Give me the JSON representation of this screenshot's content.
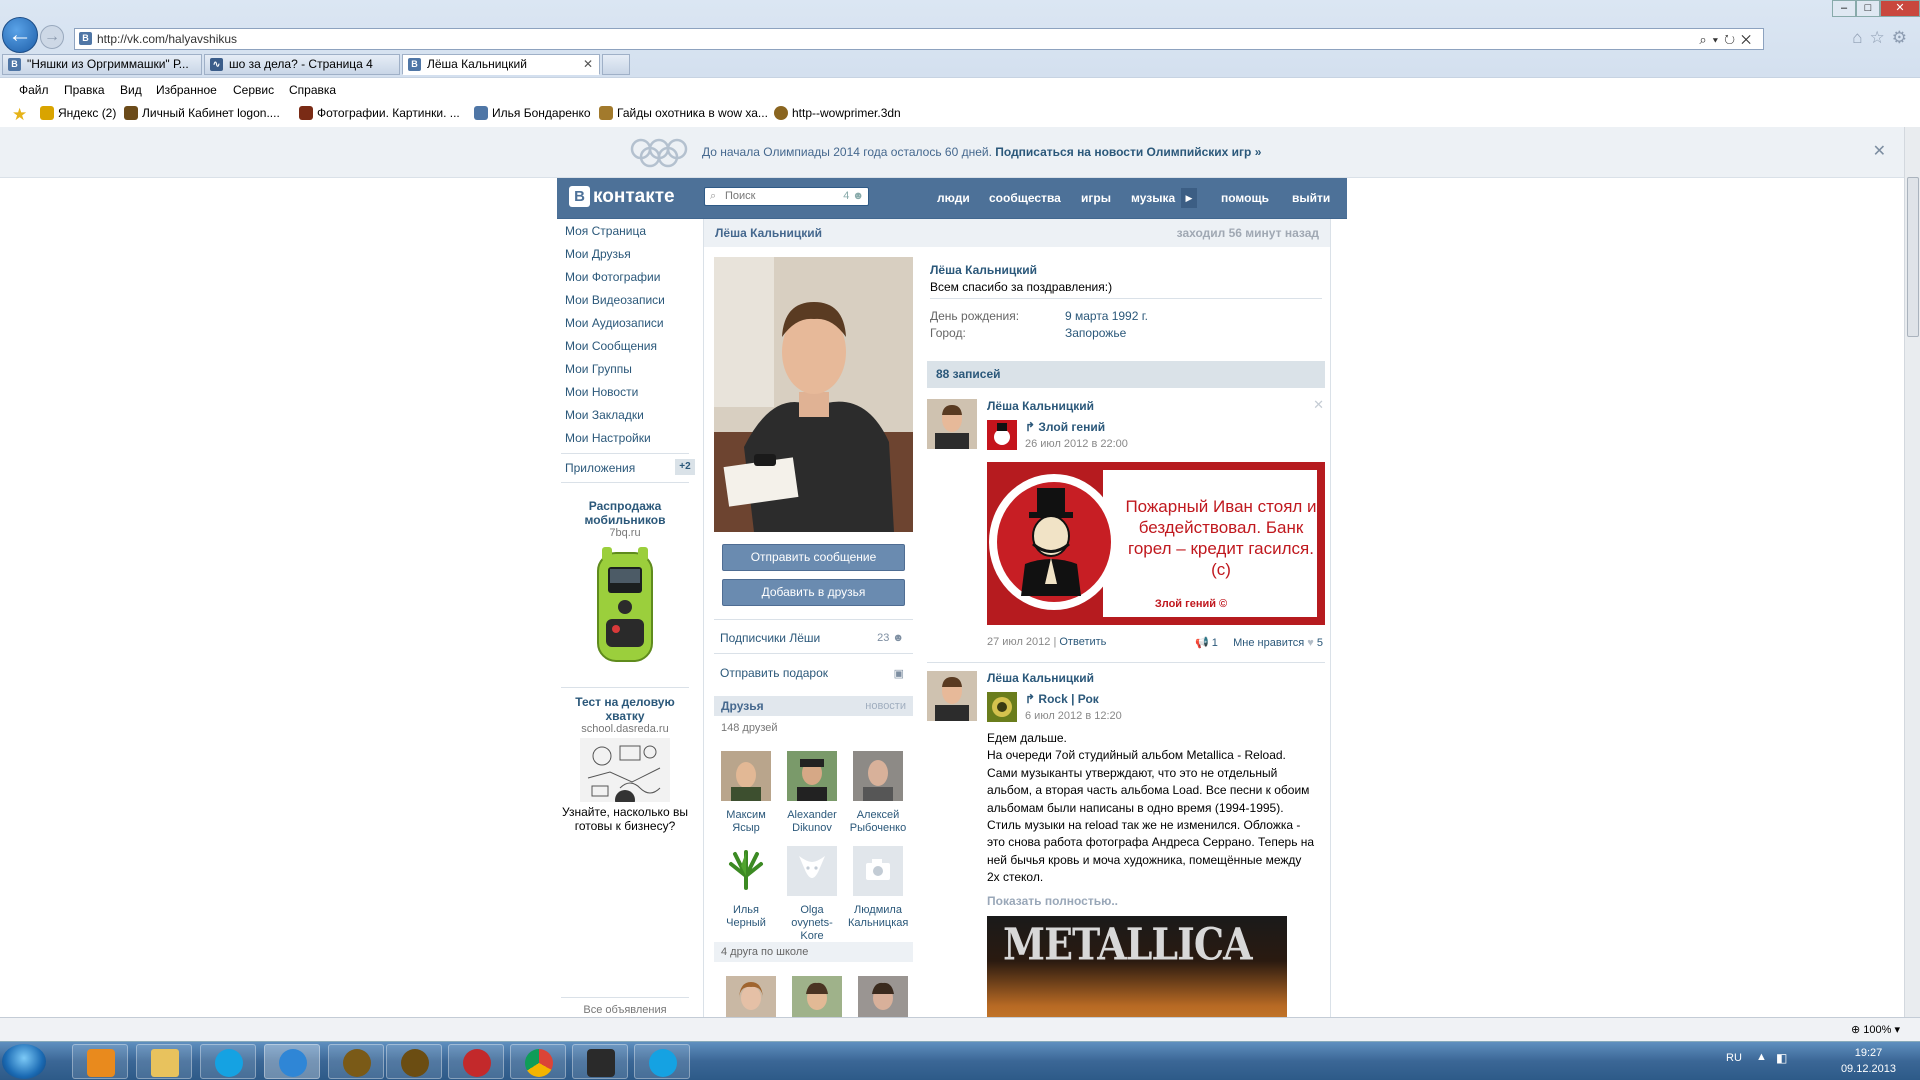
{
  "browser": {
    "url": "http://vk.com/halyavshikus",
    "tabs": [
      {
        "label": "\"Няшки из Оргриммашки\" Р..."
      },
      {
        "label": "шо за дела? - Страница 4"
      },
      {
        "label": "Лёша Кальницкий"
      }
    ],
    "menu": [
      "Файл",
      "Правка",
      "Вид",
      "Избранное",
      "Сервис",
      "Справка"
    ],
    "favorites": [
      {
        "label": "Яндекс (2)",
        "color": "#d9a400"
      },
      {
        "label": "Личный Кабинет logon....",
        "color": "#6b4b1a"
      },
      {
        "label": "Фотографии. Картинки. ...",
        "color": "#7a2b15"
      },
      {
        "label": "Илья Бондаренко",
        "color": "#4f76a6"
      },
      {
        "label": "Гайды охотника в wow ха...",
        "color": "#a27a2c"
      },
      {
        "label": "http--wowprimer.3dn",
        "color": "#8a6520"
      }
    ],
    "zoom": "100%"
  },
  "olympics": {
    "text": "До начала Олимпиады 2014 года осталось 60 дней.",
    "link": "Подписаться на новости Олимпийских игр »"
  },
  "header": {
    "logo": "контакте",
    "logo_letter": "В",
    "search_placeholder": "Поиск",
    "search_count": "4",
    "nav": [
      "люди",
      "сообщества",
      "игры",
      "музыка",
      "помощь",
      "выйти"
    ]
  },
  "sidebar": {
    "items": [
      "Моя Страница",
      "Мои Друзья",
      "Мои Фотографии",
      "Мои Видеозаписи",
      "Мои Аудиозаписи",
      "Мои Сообщения",
      "Мои Группы",
      "Мои Новости",
      "Мои Закладки",
      "Мои Настройки"
    ],
    "apps_label": "Приложения",
    "apps_badge": "+2",
    "ads": [
      {
        "title": "Распродажа мобильников",
        "domain": "7bq.ru",
        "text": ""
      },
      {
        "title": "Тест на деловую хватку",
        "domain": "school.dasreda.ru",
        "text": "Узнайте, насколько вы готовы к бизнесу?"
      }
    ],
    "all_ads": "Все объявления"
  },
  "profile": {
    "name": "Лёша Кальницкий",
    "last_seen": "заходил 56 минут назад",
    "status": "Всем спасибо за поздравления:)",
    "birthday_label": "День рождения:",
    "birthday": "9 марта 1992 г.",
    "city_label": "Город:",
    "city": "Запорожье",
    "send_message": "Отправить сообщение",
    "add_friend": "Добавить в друзья",
    "subscribers_label": "Подписчики Лёши",
    "subscribers_count": "23",
    "send_gift": "Отправить подарок",
    "friends_label": "Друзья",
    "friends_news": "новости",
    "friends_count": "148 друзей",
    "friends": [
      {
        "first": "Максим",
        "last": "Ясыр"
      },
      {
        "first": "Alexander",
        "last": "Dikunov"
      },
      {
        "first": "Алексей",
        "last": "Рыбоченко"
      },
      {
        "first": "Илья",
        "last": "Черный"
      },
      {
        "first": "Olga",
        "last": "ovynets-Kore"
      },
      {
        "first": "Людмила",
        "last": "Кальницкая"
      }
    ],
    "school_friends": "4 друга по школе"
  },
  "wall": {
    "count": "88 записей",
    "posts": [
      {
        "author": "Лёша Кальницкий",
        "source": "Злой гений",
        "date": "26 июл 2012 в 22:00",
        "image_text": "Пожарный Иван стоял и бездействовал. Банк горел – кредит гасился. (с)",
        "image_sign": "Злой гений ©",
        "footer_date": "27 июл 2012",
        "reply": "Ответить",
        "reposts": "1",
        "like_label": "Мне нравится",
        "likes": "5"
      },
      {
        "author": "Лёша Кальницкий",
        "source": "Rock | Рок",
        "date": "6 июл 2012 в 12:20",
        "text": "Едем дальше.\nНа очереди 7ой студийный альбом Metallica - Reload. Сами музыканты утверждают, что это не отдельный альбом, а вторая часть альбома Load. Все песни к обоим альбомам были написаны в одно время (1994-1995). Стиль музыки на reload так же не изменился. Обложка - это снова работа фотографа Андреса Серрано. Теперь на ней бычья кровь и моча художника, помещённые между 2х стекол.",
        "more": "Показать полностью..",
        "image_text": "METALLICA"
      }
    ]
  },
  "taskbar": {
    "lang": "RU",
    "time": "19:27",
    "date": "09.12.2013"
  }
}
